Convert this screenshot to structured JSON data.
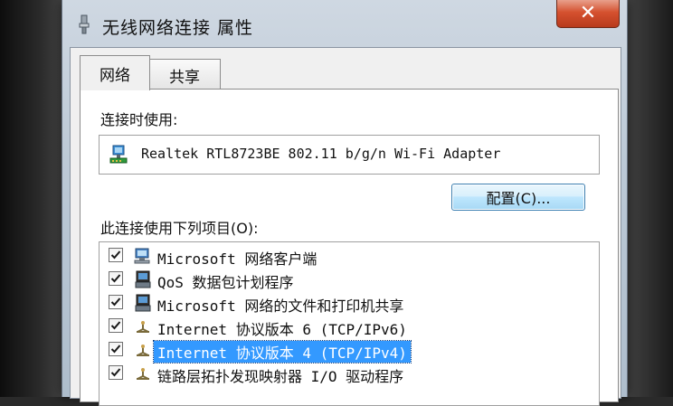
{
  "window": {
    "title": "无线网络连接 属性",
    "close_glyph": "✕"
  },
  "tabs": [
    {
      "label": "网络",
      "active": true
    },
    {
      "label": "共享",
      "active": false
    }
  ],
  "connect_using": {
    "label": "连接时使用:",
    "adapter": "Realtek RTL8723BE 802.11 b/g/n Wi-Fi Adapter"
  },
  "configure_button": "配置(C)...",
  "items_label": "此连接使用下列项目(O):",
  "items": [
    {
      "label": "Microsoft 网络客户端",
      "checked": true,
      "icon": "network-client-icon",
      "selected": false
    },
    {
      "label": "QoS 数据包计划程序",
      "checked": true,
      "icon": "service-icon",
      "selected": false
    },
    {
      "label": "Microsoft 网络的文件和打印机共享",
      "checked": true,
      "icon": "service-icon",
      "selected": false
    },
    {
      "label": "Internet 协议版本 6 (TCP/IPv6)",
      "checked": true,
      "icon": "protocol-icon",
      "selected": false
    },
    {
      "label": "Internet 协议版本 4 (TCP/IPv4)",
      "checked": true,
      "icon": "protocol-icon",
      "selected": true
    },
    {
      "label": "链路层拓扑发现映射器 I/O 驱动程序",
      "checked": true,
      "icon": "protocol-icon",
      "selected": false
    }
  ],
  "colors": {
    "selection": "#3399ff",
    "close_button": "#d5512f"
  }
}
